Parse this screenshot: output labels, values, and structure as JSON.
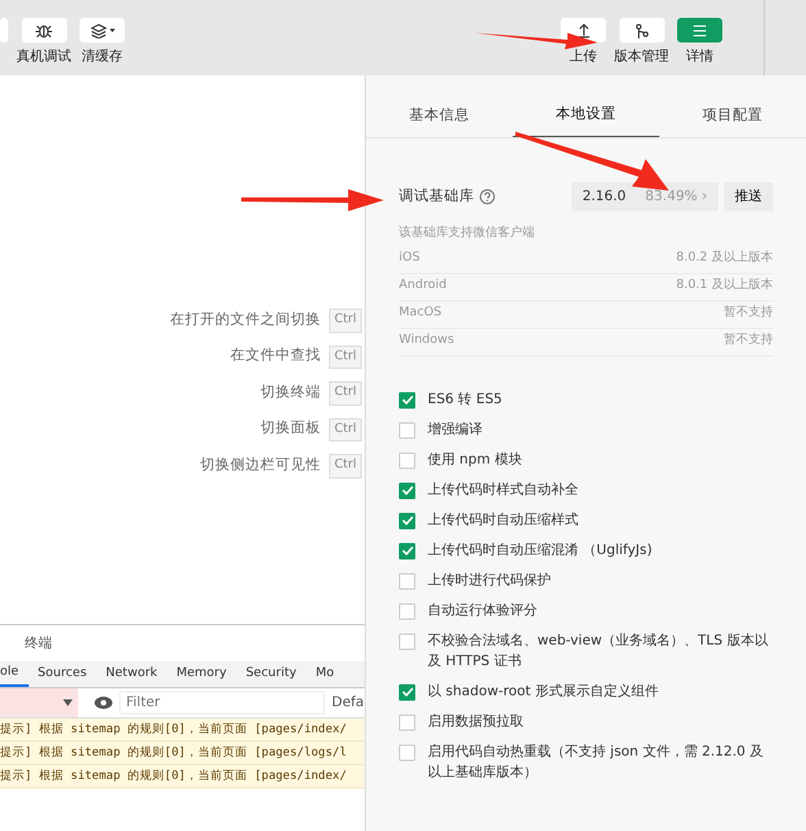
{
  "toolbar": {
    "left_buttons": [
      {
        "label": "真机调试"
      },
      {
        "label": "清缓存"
      }
    ],
    "right_buttons": [
      {
        "label": "上传",
        "selected": false
      },
      {
        "label": "版本管理",
        "selected": false
      },
      {
        "label": "详情",
        "selected": true
      }
    ]
  },
  "shortcuts": [
    {
      "label": "在打开的文件之间切换",
      "key": "Ctrl"
    },
    {
      "label": "在文件中查找",
      "key": "Ctrl"
    },
    {
      "label": "切换终端",
      "key": "Ctrl"
    },
    {
      "label": "切换面板",
      "key": "Ctrl"
    },
    {
      "label": "切换侧边栏可见性",
      "key": "Ctrl"
    }
  ],
  "devtools": {
    "panel_tab": "终端",
    "tabs": [
      {
        "label": "ole",
        "selected": true
      },
      {
        "label": "Sources",
        "selected": false
      },
      {
        "label": "Network",
        "selected": false
      },
      {
        "label": "Memory",
        "selected": false
      },
      {
        "label": "Security",
        "selected": false
      },
      {
        "label": "Mo",
        "selected": false
      }
    ],
    "filter": {
      "placeholder": "Filter"
    },
    "level_label": "Defa",
    "messages": [
      "提示] 根据 sitemap 的规则[0]，当前页面 [pages/index/",
      "提示] 根据 sitemap 的规则[0]，当前页面 [pages/logs/l",
      "提示] 根据 sitemap 的规则[0]，当前页面 [pages/index/"
    ]
  },
  "details": {
    "tabs": [
      {
        "label": "基本信息",
        "selected": false
      },
      {
        "label": "本地设置",
        "selected": true
      },
      {
        "label": "项目配置",
        "selected": false
      }
    ],
    "library": {
      "label": "调试基础库",
      "version": "2.16.0",
      "coverage": "83.49%",
      "chevron": "›",
      "push": "推送"
    },
    "support_title": "该基础库支持微信客户端",
    "support": [
      {
        "platform": "iOS",
        "value": "8.0.2 及以上版本"
      },
      {
        "platform": "Android",
        "value": "8.0.1 及以上版本"
      },
      {
        "platform": "MacOS",
        "value": "暂不支持"
      },
      {
        "platform": "Windows",
        "value": "暂不支持"
      }
    ],
    "options": [
      {
        "label": "ES6 转 ES5",
        "checked": true
      },
      {
        "label": "增强编译",
        "checked": false
      },
      {
        "label": "使用 npm 模块",
        "checked": false
      },
      {
        "label": "上传代码时样式自动补全",
        "checked": true
      },
      {
        "label": "上传代码时自动压缩样式",
        "checked": true
      },
      {
        "label": "上传代码时自动压缩混淆 （UglifyJs)",
        "checked": true
      },
      {
        "label": "上传时进行代码保护",
        "checked": false
      },
      {
        "label": "自动运行体验评分",
        "checked": false
      },
      {
        "label": "不校验合法域名、web-view（业务域名）、TLS 版本以及 HTTPS 证书",
        "checked": false
      },
      {
        "label": "以 shadow-root 形式展示自定义组件",
        "checked": true
      },
      {
        "label": "启用数据预拉取",
        "checked": false
      },
      {
        "label": "启用代码自动热重载（不支持 json 文件，需 2.12.0 及以上基础库版本）",
        "checked": false
      }
    ]
  }
}
